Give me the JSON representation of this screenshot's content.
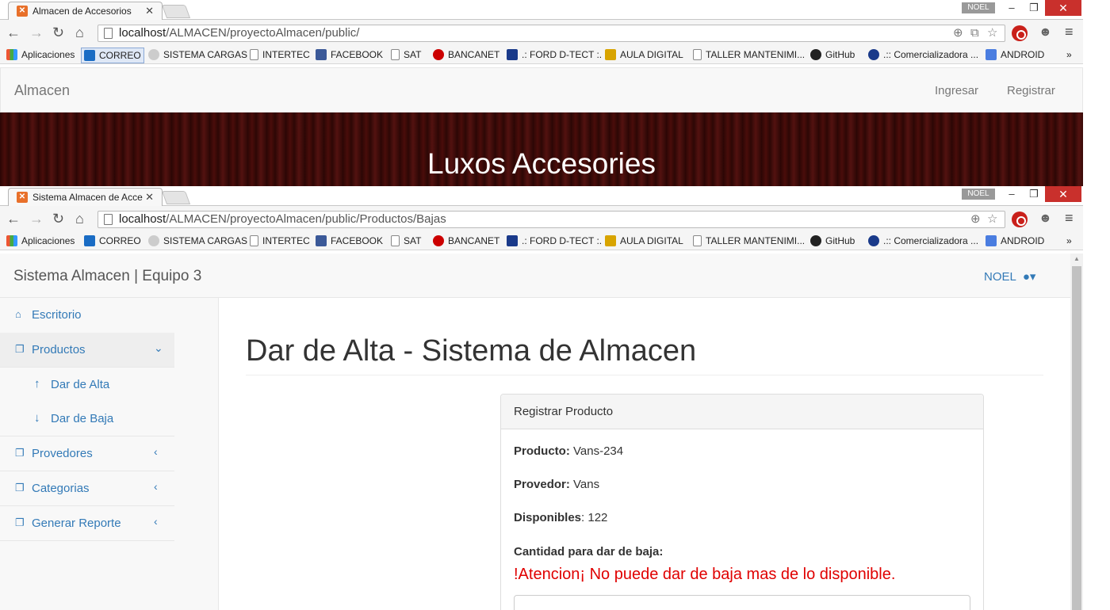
{
  "windows": [
    {
      "tab_title": "Almacen de Accesorios",
      "user_badge": "NOEL",
      "url_host": "localhost",
      "url_path": "/ALMACEN/proyectoAlmacen/public/",
      "page": {
        "brand": "Almacen",
        "links": [
          "Ingresar",
          "Registrar"
        ],
        "hero_title": "Luxos Accesories"
      }
    },
    {
      "tab_title": "Sistema Almacen de Acce",
      "user_badge": "NOEL",
      "url_host": "localhost",
      "url_path": "/ALMACEN/proyectoAlmacen/public/Productos/Bajas",
      "page": {
        "brand": "Sistema Almacen | Equipo 3",
        "user_menu": "NOEL",
        "sidebar": {
          "items": [
            {
              "label": "Escritorio",
              "icon": "home-icon"
            },
            {
              "label": "Productos",
              "icon": "copy-icon"
            },
            {
              "label": "Dar de Alta",
              "icon": "arrow-up-icon"
            },
            {
              "label": "Dar de Baja",
              "icon": "arrow-down-icon"
            },
            {
              "label": "Provedores",
              "icon": "copy-icon"
            },
            {
              "label": "Categorias",
              "icon": "copy-icon"
            },
            {
              "label": "Generar Reporte",
              "icon": "copy-icon"
            }
          ]
        },
        "heading": "Dar de Alta - Sistema de Almacen",
        "panel": {
          "title": "Registrar Producto",
          "producto_label": "Producto:",
          "producto_value": "Vans-234",
          "provedor_label": "Provedor:",
          "provedor_value": "Vans",
          "disponibles_label": "Disponibles",
          "disponibles_value": ": 122",
          "cantidad_label": "Cantidad para dar de baja:",
          "warning": "!Atencion¡ No puede dar de baja mas de lo disponible."
        }
      }
    }
  ],
  "bookmarks": [
    "Aplicaciones",
    "CORREO",
    "SISTEMA CARGAS",
    "INTERTEC",
    "FACEBOOK",
    "SAT",
    "BANCANET",
    ".: FORD D-TECT :.",
    "AULA DIGITAL",
    "TALLER MANTENIMI...",
    "GitHub",
    ".:: Comercializadora ...",
    "ANDROID"
  ],
  "colors": {
    "link": "#337ab7",
    "warning": "#e00000",
    "close": "#c9302c",
    "hero": "#3a0907"
  }
}
